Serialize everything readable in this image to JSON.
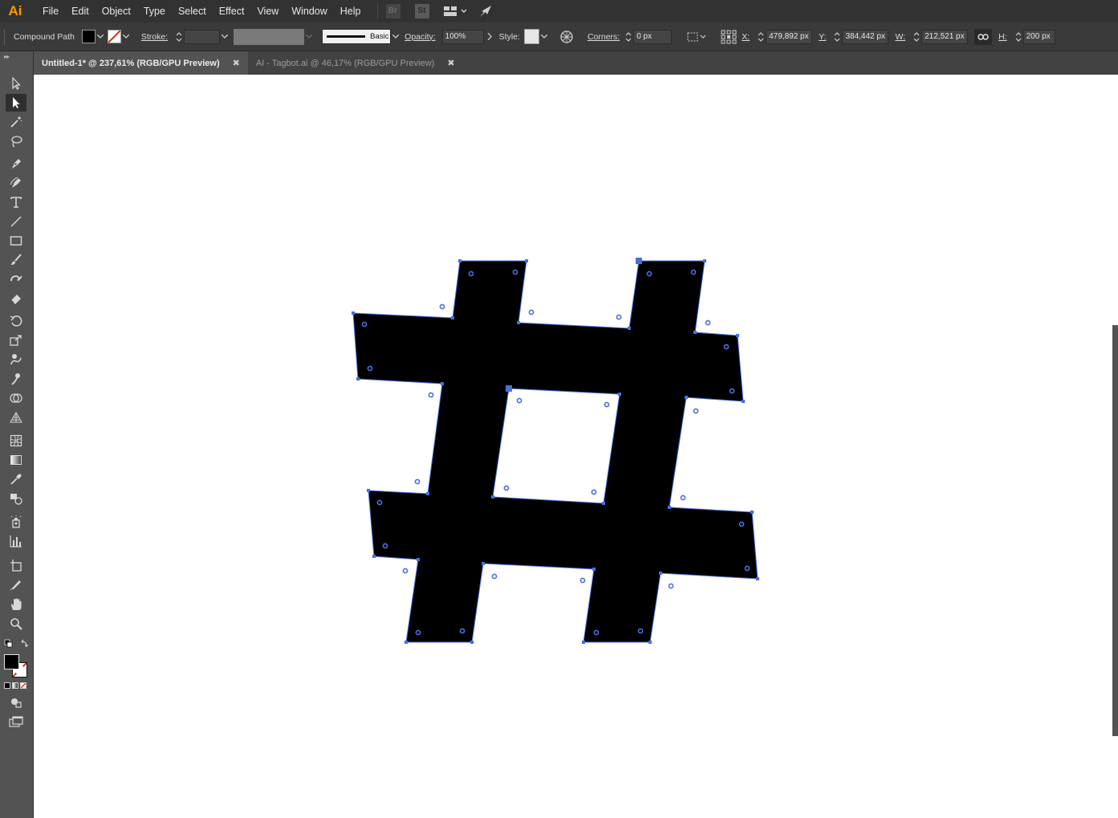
{
  "app": {
    "logo_text": "Ai",
    "accent": "#ff9a00"
  },
  "menu": [
    "File",
    "Edit",
    "Object",
    "Type",
    "Select",
    "Effect",
    "View",
    "Window",
    "Help"
  ],
  "app_buttons": {
    "bridge": "Br",
    "stock": "St"
  },
  "controlbar": {
    "selection_type": "Compound Path",
    "stroke_label": "Stroke:",
    "brush_label": "Basic",
    "opacity_label": "Opacity:",
    "opacity_value": "100%",
    "style_label": "Style:",
    "corners_label": "Corners:",
    "corners_value": "0 px",
    "x_label": "X:",
    "x_value": "479,892 px",
    "y_label": "Y:",
    "y_value": "384,442 px",
    "w_label": "W:",
    "w_value": "212,521 px",
    "h_label": "H:",
    "h_value": "200 px"
  },
  "tabs": [
    {
      "label": "Untitled-1* @ 237,61% (RGB/GPU Preview)",
      "active": true
    },
    {
      "label": "AI - Tagbot.ai @ 46,17% (RGB/GPU Preview)",
      "active": false
    }
  ],
  "tools": [
    "selection-tool",
    "direct-selection-tool",
    "magic-wand-tool",
    "lasso-tool",
    "pen-tool",
    "curvature-tool",
    "type-tool",
    "line-segment-tool",
    "rectangle-tool",
    "paintbrush-tool",
    "shaper-tool",
    "eraser-tool",
    "rotate-tool",
    "scale-tool",
    "warp-tool",
    "puppet-warp-tool",
    "shape-builder-tool",
    "perspective-grid-tool",
    "mesh-tool",
    "gradient-tool",
    "eyedropper-tool",
    "blend-tool",
    "symbol-sprayer-tool",
    "column-graph-tool",
    "artboard-tool",
    "slice-tool",
    "hand-tool",
    "zoom-tool"
  ],
  "colors": {
    "fill": "#000000",
    "selection": "#4a6ee0",
    "canvas": "#ffffff"
  }
}
